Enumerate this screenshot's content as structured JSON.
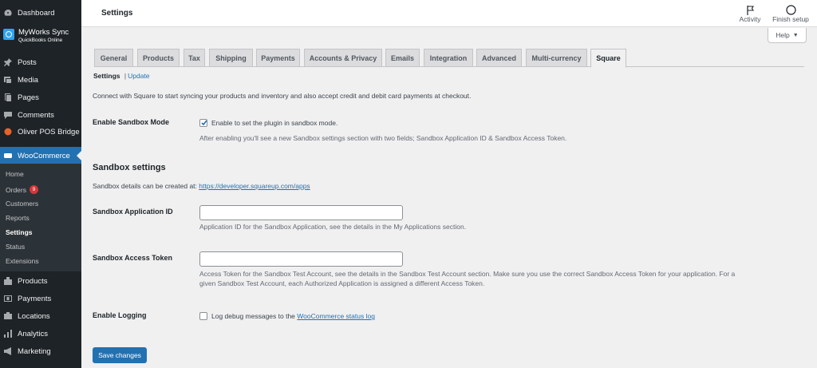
{
  "sidebar": {
    "dashboard": "Dashboard",
    "myworks_title": "MyWorks Sync",
    "myworks_sub": "QuickBooks Online",
    "posts": "Posts",
    "media": "Media",
    "pages": "Pages",
    "comments": "Comments",
    "oliver": "Oliver POS Bridge",
    "woocommerce": "WooCommerce",
    "submenu": {
      "home": "Home",
      "orders": "Orders",
      "orders_count": "9",
      "customers": "Customers",
      "reports": "Reports",
      "settings": "Settings",
      "status": "Status",
      "extensions": "Extensions"
    },
    "products": "Products",
    "payments": "Payments",
    "locations": "Locations",
    "analytics": "Analytics",
    "marketing": "Marketing"
  },
  "header": {
    "title": "Settings",
    "activity": "Activity",
    "finish_setup": "Finish setup",
    "help": "Help"
  },
  "tabs": [
    "General",
    "Products",
    "Tax",
    "Shipping",
    "Payments",
    "Accounts & Privacy",
    "Emails",
    "Integration",
    "Advanced",
    "Multi-currency",
    "Square"
  ],
  "active_tab": "Square",
  "subsubsub": {
    "current": "Settings",
    "separator": "|",
    "link": "Update"
  },
  "intro": "Connect with Square to start syncing your products and inventory and also accept credit and debit card payments at checkout.",
  "sandbox_mode": {
    "label": "Enable Sandbox Mode",
    "checkbox_label": "Enable to set the plugin in sandbox mode.",
    "checked": true,
    "description": "After enabling you'll see a new Sandbox settings section with two fields; Sandbox Application ID & Sandbox Access Token."
  },
  "sandbox_settings": {
    "heading": "Sandbox settings",
    "details_text": "Sandbox details can be created at:",
    "details_link": "https://developer.squareup.com/apps"
  },
  "app_id": {
    "label": "Sandbox Application ID",
    "value": "",
    "description": "Application ID for the Sandbox Application, see the details in the My Applications section."
  },
  "access_token": {
    "label": "Sandbox Access Token",
    "value": "",
    "description_line1": "Access Token for the Sandbox Test Account, see the details in the Sandbox Test Account section. Make sure you use the correct Sandbox Access Token for your application. For a",
    "description_line2": "given Sandbox Test Account, each Authorized Application is assigned a different Access Token."
  },
  "logging": {
    "label": "Enable Logging",
    "checkbox_text": "Log debug messages to the",
    "link": "WooCommerce status log",
    "checked": false
  },
  "save_button": "Save changes",
  "colors": {
    "sidebar_bg": "#1d2327",
    "submenu_bg": "#2c3338",
    "accent": "#2271b1",
    "badge": "#d63638",
    "page_bg": "#f0f0f1"
  }
}
